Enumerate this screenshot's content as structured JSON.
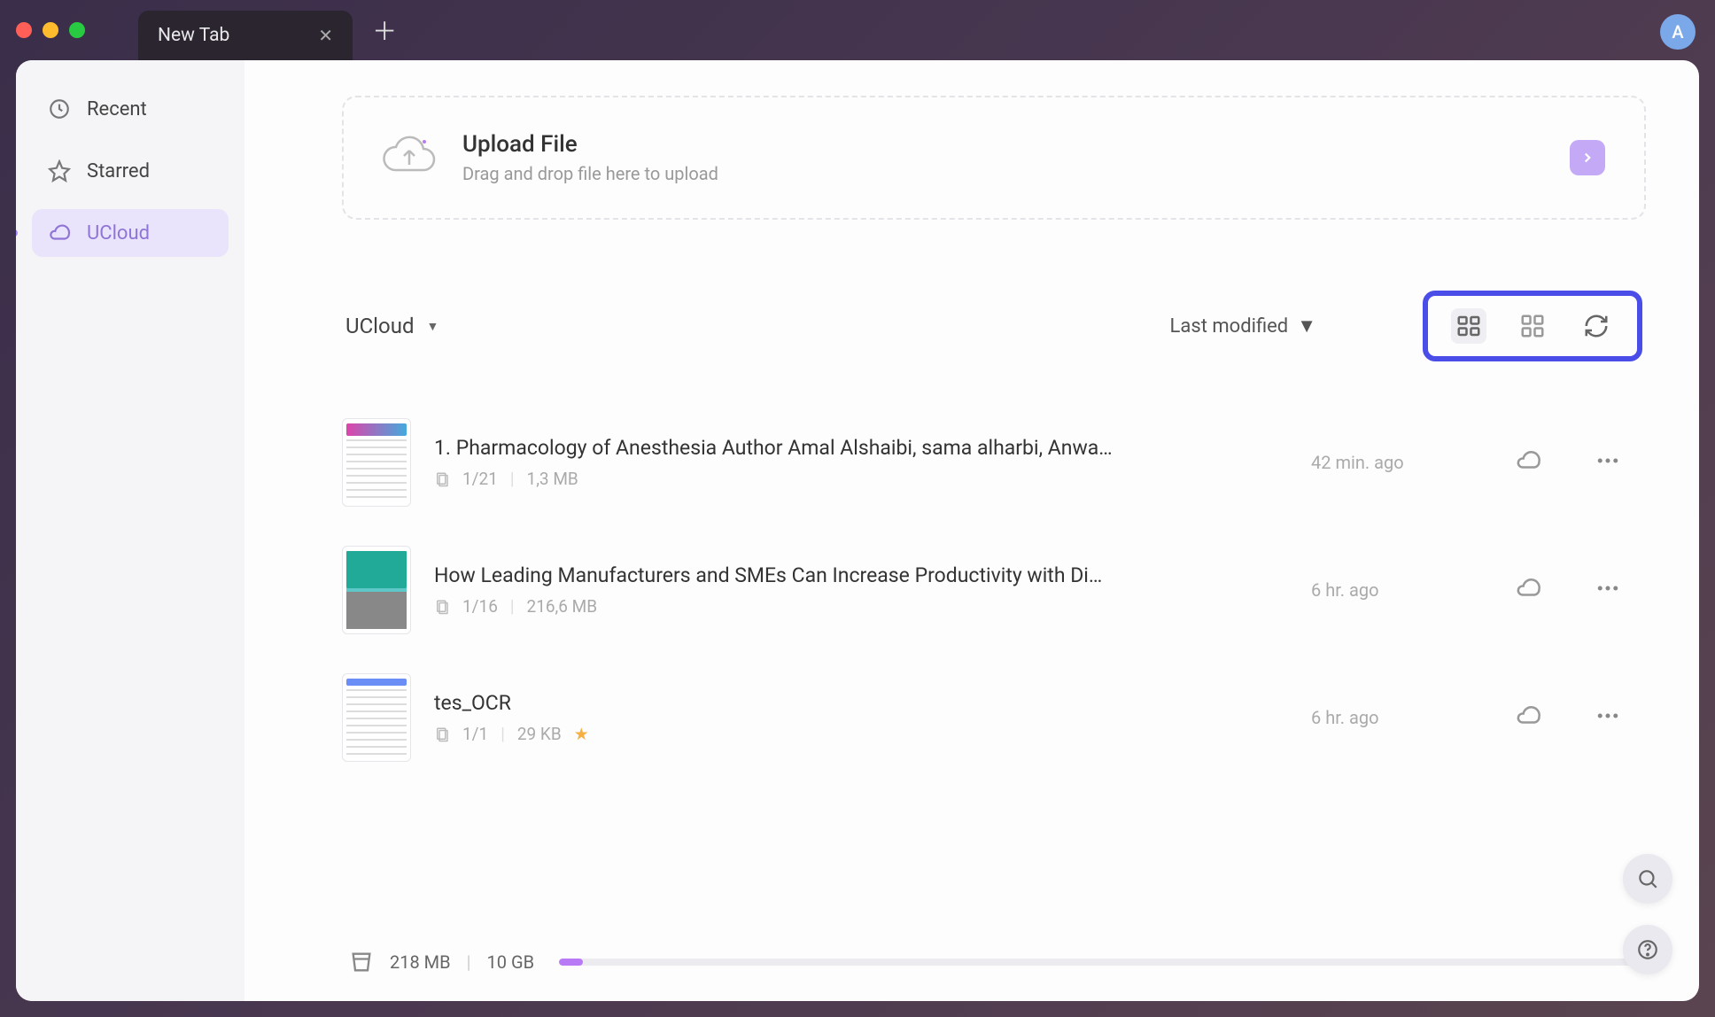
{
  "titlebar": {
    "tab_label": "New Tab",
    "avatar_letter": "A"
  },
  "sidebar": {
    "items": [
      {
        "label": "Recent"
      },
      {
        "label": "Starred"
      },
      {
        "label": "UCloud"
      }
    ]
  },
  "upload": {
    "title": "Upload File",
    "subtitle": "Drag and drop file here to upload"
  },
  "toolbar": {
    "location": "UCloud",
    "sort": "Last modified"
  },
  "files": [
    {
      "name": "1. Pharmacology of Anesthesia Author Amal Alshaibi, sama alharbi, Anwa…",
      "pages": "1/21",
      "size": "1,3 MB",
      "time": "42 min. ago",
      "starred": false
    },
    {
      "name": "How Leading Manufacturers and SMEs Can Increase Productivity with Di…",
      "pages": "1/16",
      "size": "216,6 MB",
      "time": "6 hr. ago",
      "starred": false
    },
    {
      "name": "tes_OCR",
      "pages": "1/1",
      "size": "29 KB",
      "time": "6 hr. ago",
      "starred": true
    }
  ],
  "storage": {
    "used": "218 MB",
    "total": "10 GB"
  }
}
